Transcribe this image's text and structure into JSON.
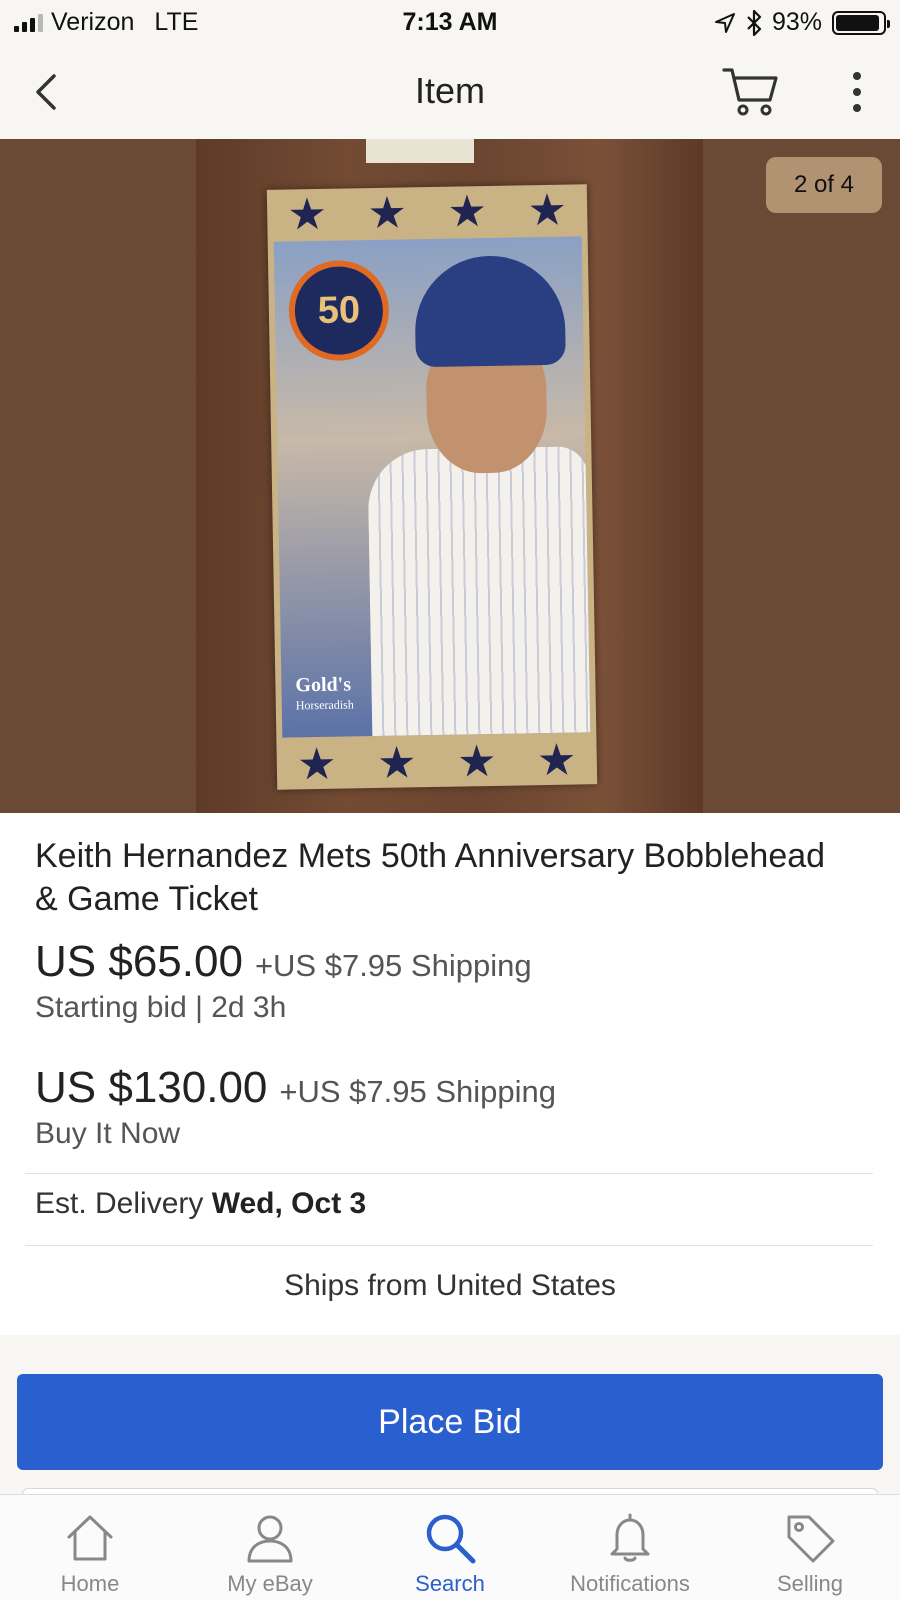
{
  "status_bar": {
    "carrier": "Verizon",
    "network": "LTE",
    "time": "7:13 AM",
    "battery": "93%",
    "battery_level": 0.93
  },
  "nav": {
    "title": "Item",
    "icons": [
      "back-chevron-icon",
      "cart-icon",
      "more-vertical-icon"
    ]
  },
  "gallery": {
    "counter": "2 of 4",
    "logo_text": "50",
    "box_brand": "Gold's",
    "box_brand_sub": "Horseradish"
  },
  "item": {
    "title": "Keith Hernandez Mets 50th Anniversary Bobblehead & Game Ticket",
    "bid_price": "US $65.00",
    "bid_shipping": "+US $7.95 Shipping",
    "bid_sub": "Starting bid | 2d 3h",
    "bin_price": "US $130.00",
    "bin_shipping": "+US $7.95 Shipping",
    "bin_sub": "Buy It Now",
    "delivery_label": "Est. Delivery",
    "delivery_date": "Wed, Oct 3",
    "ships_from": "Ships from United States"
  },
  "actions": {
    "place_bid": "Place Bid"
  },
  "tabs": [
    {
      "label": "Home",
      "icon": "home-icon",
      "active": false
    },
    {
      "label": "My eBay",
      "icon": "person-icon",
      "active": false
    },
    {
      "label": "Search",
      "icon": "search-icon",
      "active": true
    },
    {
      "label": "Notifications",
      "icon": "bell-icon",
      "active": false
    },
    {
      "label": "Selling",
      "icon": "tag-icon",
      "active": false
    }
  ],
  "colors": {
    "accent": "#2b5fcc",
    "button": "#2a5fd0",
    "background": "#f7f6f2"
  }
}
